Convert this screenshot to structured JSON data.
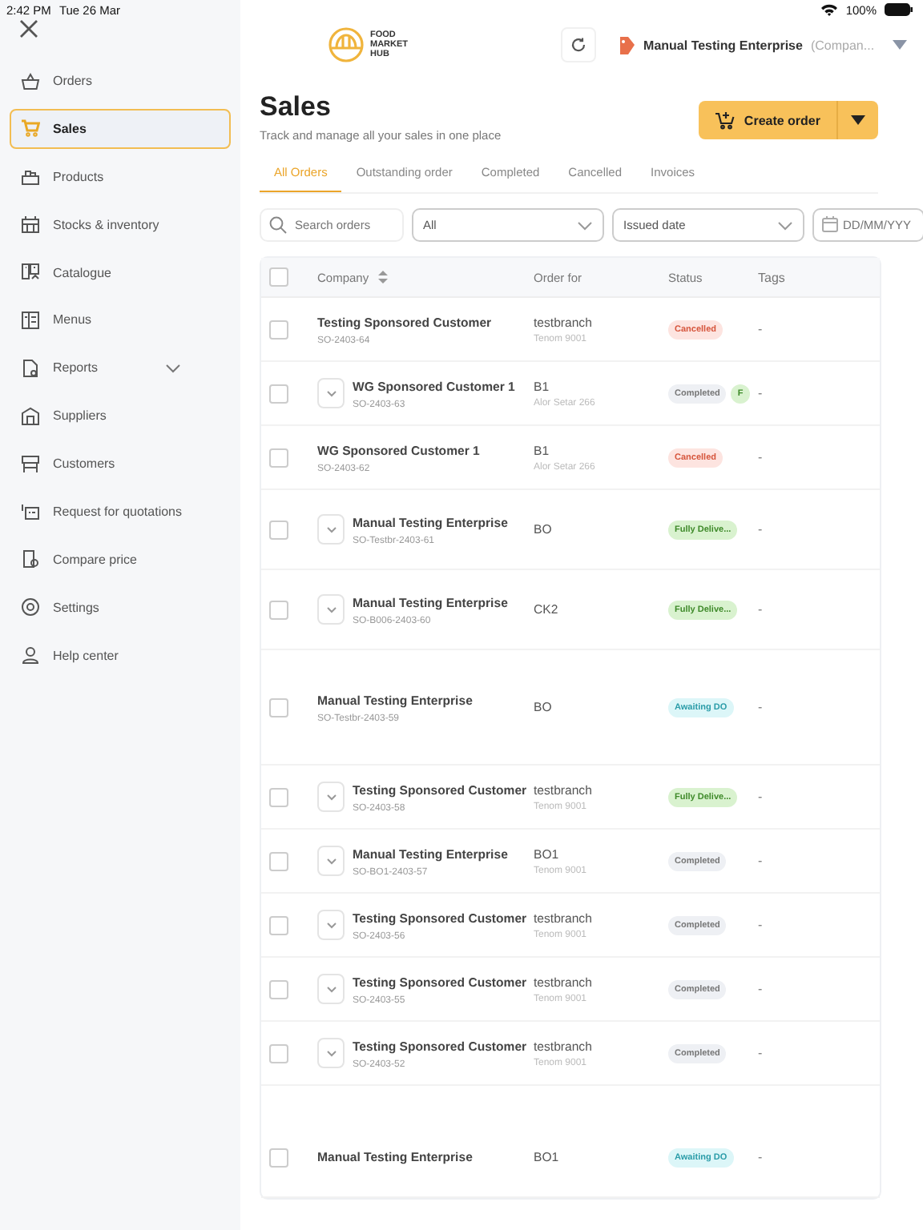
{
  "status_bar": {
    "time": "2:42 PM",
    "date": "Tue 26 Mar",
    "battery": "100%"
  },
  "sidebar": {
    "items": [
      {
        "label": "Orders",
        "selected": false,
        "expandable": false
      },
      {
        "label": "Sales",
        "selected": true,
        "expandable": false
      },
      {
        "label": "Products",
        "selected": false,
        "expandable": false
      },
      {
        "label": "Stocks & inventory",
        "selected": false,
        "expandable": false
      },
      {
        "label": "Catalogue",
        "selected": false,
        "expandable": false
      },
      {
        "label": "Menus",
        "selected": false,
        "expandable": false
      },
      {
        "label": "Reports",
        "selected": false,
        "expandable": true
      },
      {
        "label": "Suppliers",
        "selected": false,
        "expandable": false
      },
      {
        "label": "Customers",
        "selected": false,
        "expandable": false
      },
      {
        "label": "Request for quotations",
        "selected": false,
        "expandable": false
      },
      {
        "label": "Compare price",
        "selected": false,
        "expandable": false
      },
      {
        "label": "Settings",
        "selected": false,
        "expandable": false
      },
      {
        "label": "Help center",
        "selected": false,
        "expandable": false
      }
    ]
  },
  "header": {
    "logo_text": [
      "FOOD",
      "MARKET",
      "HUB"
    ],
    "company": "Manual Testing Enterprise",
    "company_role": "(Compan..."
  },
  "page": {
    "title": "Sales",
    "subtitle": "Track and manage all your sales in one place",
    "create_button": "Create order"
  },
  "tabs": [
    {
      "label": "All Orders",
      "selected": true
    },
    {
      "label": "Outstanding order",
      "selected": false
    },
    {
      "label": "Completed",
      "selected": false
    },
    {
      "label": "Cancelled",
      "selected": false
    },
    {
      "label": "Invoices",
      "selected": false
    }
  ],
  "filters": {
    "search_placeholder": "Search orders",
    "status": "All",
    "date_type": "Issued date",
    "date_placeholder": "DD/MM/YYY"
  },
  "table": {
    "columns": [
      "Company",
      "Order for",
      "Status",
      "Tags"
    ],
    "select_all_checked": false,
    "rows": [
      {
        "company": "Testing Sponsored Customer",
        "order_no": "SO-2403-64",
        "branch": "testbranch",
        "branch_sub": "Tenom 9001",
        "statuses": [
          {
            "label": "Cancelled",
            "kind": "cancelled"
          }
        ],
        "tags": "-",
        "expandable": false,
        "checked": false
      },
      {
        "company": "WG Sponsored Customer 1",
        "order_no": "SO-2403-63",
        "branch": "B1",
        "branch_sub": "Alor Setar 266",
        "statuses": [
          {
            "label": "Completed",
            "kind": "completed"
          },
          {
            "label": "F",
            "kind": "delivered"
          }
        ],
        "tags": "-",
        "expandable": true,
        "checked": false
      },
      {
        "company": "WG Sponsored Customer 1",
        "order_no": "SO-2403-62",
        "branch": "B1",
        "branch_sub": "Alor Setar 266",
        "statuses": [
          {
            "label": "Cancelled",
            "kind": "cancelled"
          }
        ],
        "tags": "-",
        "expandable": false,
        "checked": false
      },
      {
        "company": "Manual Testing Enterprise",
        "order_no": "SO-Testbr-2403-61",
        "branch": "BO",
        "statuses": [
          {
            "label": "Fully Delive...",
            "kind": "delivered"
          }
        ],
        "tags": "-",
        "expandable": true,
        "checked": false
      },
      {
        "company": "Manual Testing Enterprise",
        "order_no": "SO-B006-2403-60",
        "branch": "CK2",
        "statuses": [
          {
            "label": "Fully Delive...",
            "kind": "delivered"
          }
        ],
        "tags": "-",
        "expandable": true,
        "checked": false
      },
      {
        "company": "Manual Testing Enterprise",
        "order_no": "SO-Testbr-2403-59",
        "branch": "BO",
        "statuses": [
          {
            "label": "Awaiting DO",
            "kind": "awaiting"
          }
        ],
        "tags": "-",
        "expandable": false,
        "checked": false
      },
      {
        "company": "Testing Sponsored Customer",
        "order_no": "SO-2403-58",
        "branch": "testbranch",
        "branch_sub": "Tenom 9001",
        "statuses": [
          {
            "label": "Fully Delive...",
            "kind": "delivered"
          }
        ],
        "tags": "-",
        "expandable": true,
        "checked": false
      },
      {
        "company": "Manual Testing Enterprise",
        "order_no": "SO-BO1-2403-57",
        "branch": "BO1",
        "branch_sub": "Tenom 9001",
        "statuses": [
          {
            "label": "Completed",
            "kind": "completed"
          }
        ],
        "tags": "-",
        "expandable": true,
        "checked": false
      },
      {
        "company": "Testing Sponsored Customer",
        "order_no": "SO-2403-56",
        "branch": "testbranch",
        "branch_sub": "Tenom 9001",
        "statuses": [
          {
            "label": "Completed",
            "kind": "completed"
          }
        ],
        "tags": "-",
        "expandable": true,
        "checked": false
      },
      {
        "company": "Testing Sponsored Customer",
        "order_no": "SO-2403-55",
        "branch": "testbranch",
        "branch_sub": "Tenom 9001",
        "statuses": [
          {
            "label": "Completed",
            "kind": "completed"
          }
        ],
        "tags": "-",
        "expandable": true,
        "checked": false
      },
      {
        "company": "Testing Sponsored Customer",
        "order_no": "SO-2403-52",
        "branch": "testbranch",
        "branch_sub": "Tenom 9001",
        "statuses": [
          {
            "label": "Completed",
            "kind": "completed"
          }
        ],
        "tags": "-",
        "expandable": true,
        "checked": false
      },
      {
        "company": "Manual Testing Enterprise",
        "branch": "BO1",
        "statuses": [
          {
            "label": "Awaiting DO",
            "kind": "awaiting"
          }
        ],
        "tags": "-",
        "expandable": false,
        "checked": false
      }
    ]
  }
}
